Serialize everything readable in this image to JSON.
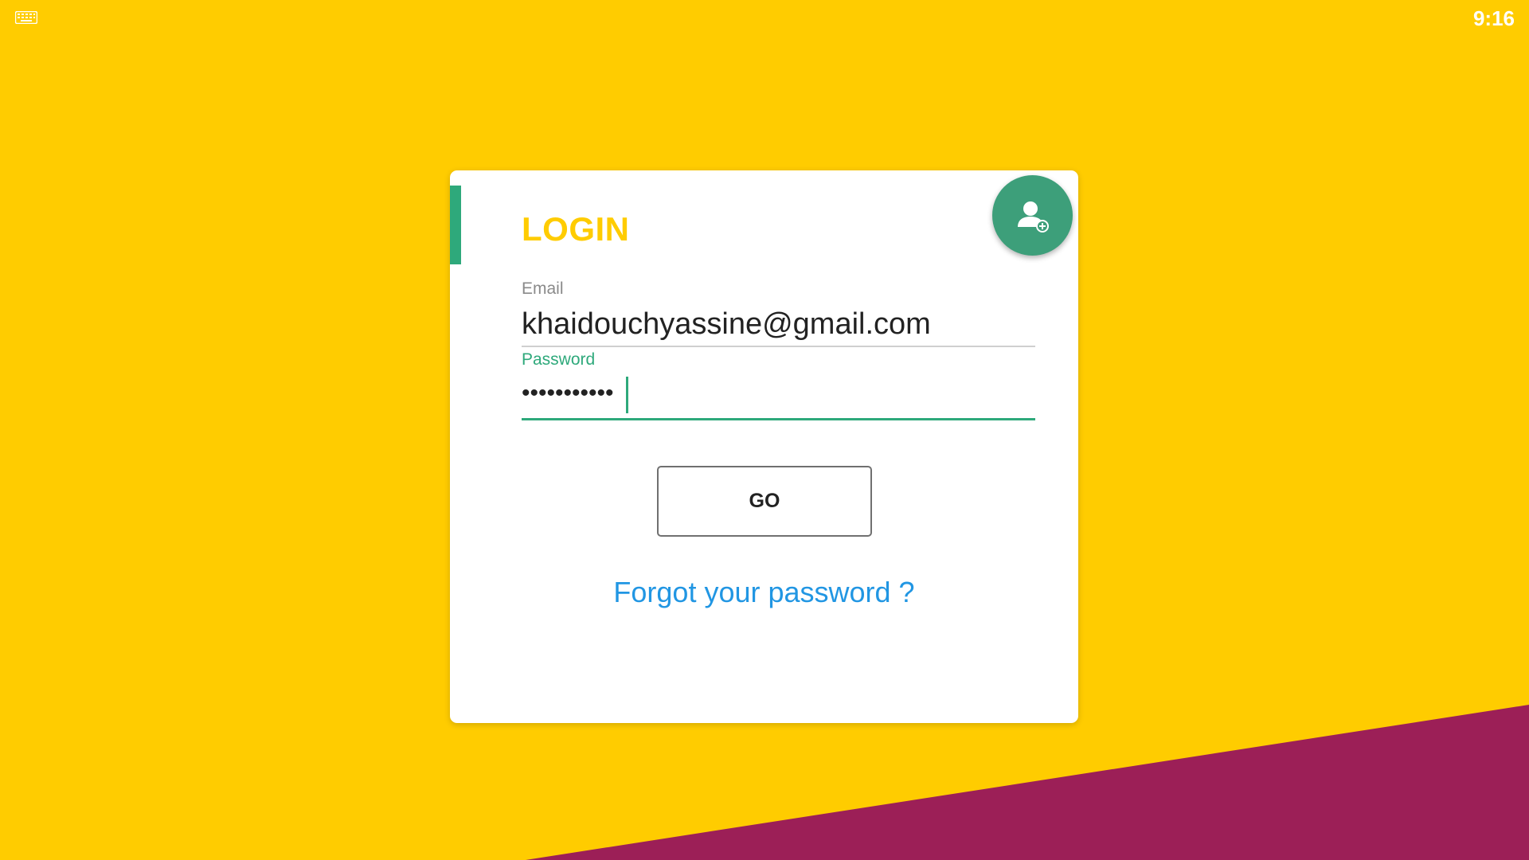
{
  "status_bar": {
    "time": "9:16",
    "keyboard_icon": "keyboard-icon"
  },
  "login": {
    "title": "LOGIN",
    "add_user_icon": "add-user-icon",
    "email": {
      "label": "Email",
      "value": "khaidouchyassine@gmail.com"
    },
    "password": {
      "label": "Password",
      "masked_value": "•••••••••••"
    },
    "go_label": "GO",
    "forgot_label": "Forgot your password ?"
  },
  "colors": {
    "background": "#FFCC00",
    "stripe": "#9C1F57",
    "accent_green": "#2EA97B",
    "fab": "#3D9F7A",
    "link": "#2196E3",
    "title": "#FFCC00"
  }
}
